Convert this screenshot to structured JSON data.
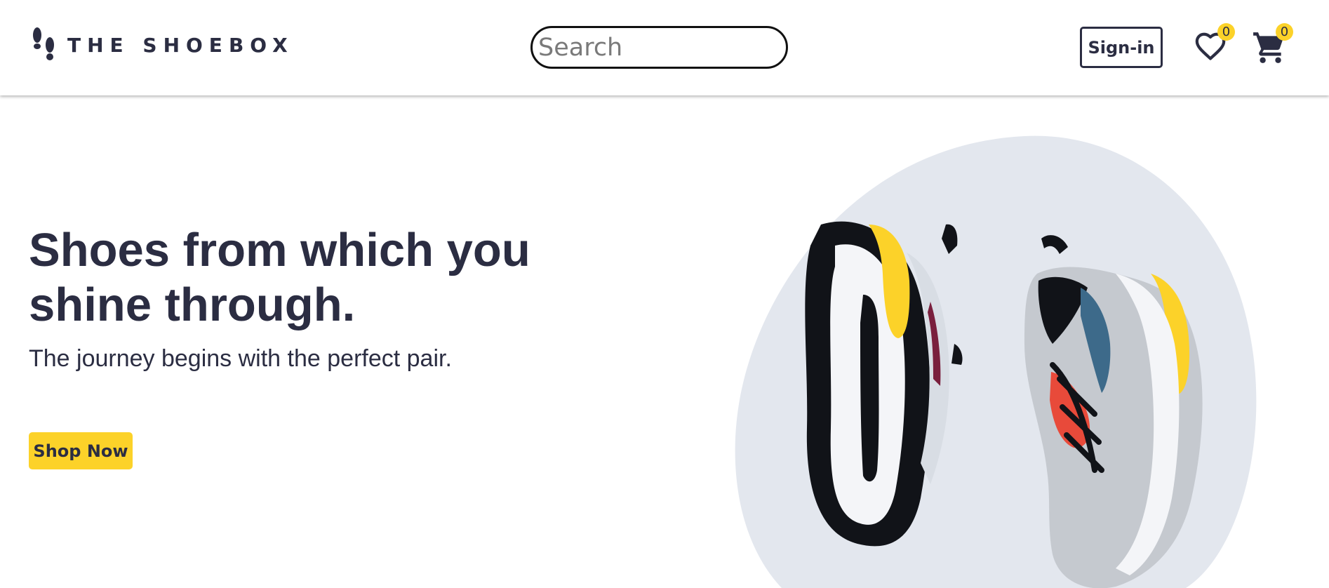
{
  "brand": {
    "name": "THE SHOEBOX",
    "logo_icon": "footprints-icon"
  },
  "header": {
    "search": {
      "placeholder": "Search",
      "value": ""
    },
    "signin_label": "Sign-in",
    "wishlist": {
      "icon": "heart-icon",
      "count": "0"
    },
    "cart": {
      "icon": "shopping-cart-icon",
      "count": "0"
    }
  },
  "hero": {
    "title": "Shoes from which you shine through.",
    "subtitle": "The journey begins with the perfect pair.",
    "cta_label": "Shop Now",
    "image_icon": "sneakers-pair-image"
  },
  "colors": {
    "primary_text": "#2b2d42",
    "accent_yellow": "#fcd229",
    "background": "#ffffff",
    "image_backdrop": "#e3e7ee"
  }
}
